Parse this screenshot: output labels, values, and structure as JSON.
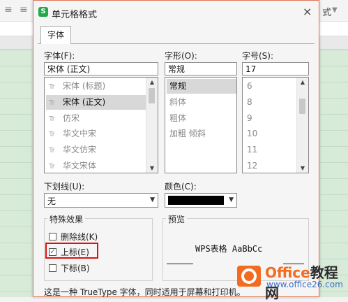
{
  "background": {
    "toolbar_glyph_1": "≡",
    "toolbar_glyph_2": "≡",
    "toolbar_right_label": "式"
  },
  "dialog": {
    "title": "单元格格式",
    "app_icon_letter": "S",
    "close_icon": "×",
    "tab_label": "字体"
  },
  "font": {
    "label": "字体(F):",
    "value": "宋体 (正文)",
    "items": [
      {
        "text": "宋体 (标题)",
        "selected": false
      },
      {
        "text": "宋体 (正文)",
        "selected": true
      },
      {
        "text": "仿宋",
        "selected": false
      },
      {
        "text": "华文中宋",
        "selected": false
      },
      {
        "text": "华文仿宋",
        "selected": false
      },
      {
        "text": "华文宋体",
        "selected": false
      }
    ],
    "truetype_glyph": "Tr"
  },
  "style": {
    "label": "字形(O):",
    "value": "常规",
    "items": [
      {
        "text": "常规",
        "selected": true
      },
      {
        "text": "斜体",
        "selected": false
      },
      {
        "text": "粗体",
        "selected": false
      },
      {
        "text": "加粗 倾斜",
        "selected": false
      }
    ]
  },
  "size": {
    "label": "字号(S):",
    "value": "17",
    "items": [
      "6",
      "8",
      "9",
      "10",
      "11",
      "12"
    ]
  },
  "underline": {
    "label": "下划线(U):",
    "value": "无"
  },
  "color": {
    "label": "颜色(C):",
    "value": "#000000"
  },
  "effects": {
    "title": "特殊效果",
    "strikethrough": {
      "label": "删除线(K)",
      "checked": false
    },
    "superscript": {
      "label": "上标(E)",
      "checked": true
    },
    "subscript": {
      "label": "下标(B)",
      "checked": false
    },
    "check_glyph": "✓"
  },
  "preview": {
    "title": "预览",
    "text": "WPS表格  AaBbCc"
  },
  "footer": {
    "text": "这是一种 TrueType 字体，同时适用于屏幕和打印机。"
  },
  "watermark": {
    "title_prefix": "Office",
    "title_suffix": "教程网",
    "url": "www.office26.com"
  },
  "colors": {
    "accent_border": "#e0795a",
    "highlight_box": "#e01010",
    "app_icon": "#23a84a",
    "watermark_orange": "#f36b21"
  }
}
